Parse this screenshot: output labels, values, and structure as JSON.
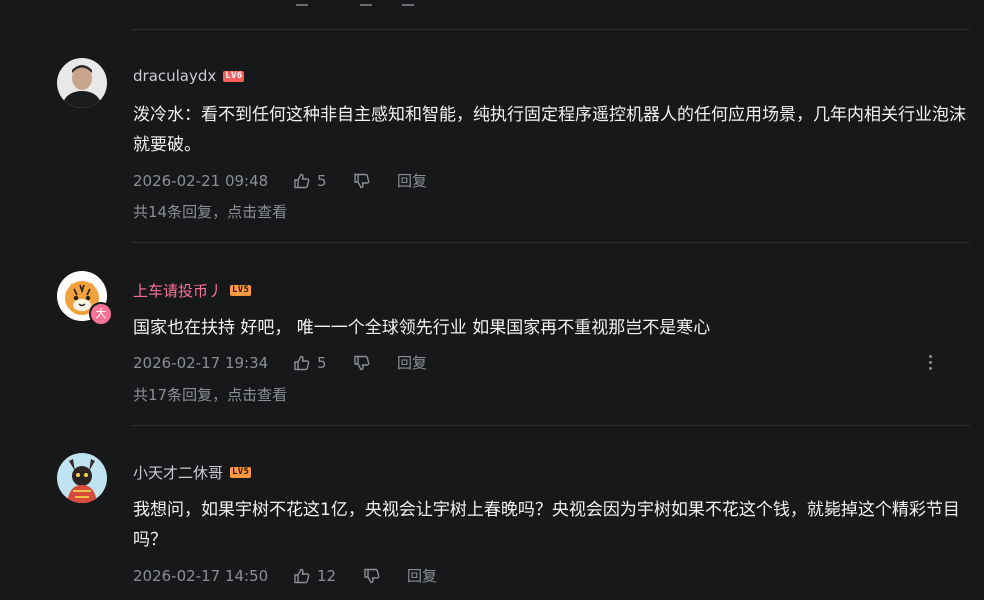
{
  "colors": {
    "background": "#17181a",
    "pink_name": "#fb7299",
    "lv6": "#ff5c5c",
    "lv5": "#ff9a3c",
    "meta": "#8b8f95"
  },
  "comments": [
    {
      "username": "draculaydx",
      "level": "LV6",
      "content": "泼冷水：看不到任何这种非自主感知和智能，纯执行固定程序遥控机器人的任何应用场景，几年内相关行业泡沫就要破。",
      "time": "2026-02-21 09:48",
      "likes": "5",
      "reply_label": "回复",
      "replies_text": "共14条回复，点击查看"
    },
    {
      "username": "上车请投币丿",
      "level": "LV5",
      "avatar_badge": "大",
      "content": "国家也在扶持 好吧， 唯一一个全球领先行业 如果国家再不重视那岂不是寒心",
      "time": "2026-02-17 19:34",
      "likes": "5",
      "reply_label": "回复",
      "replies_text": "共17条回复，点击查看"
    },
    {
      "username": "小天才二休哥",
      "level": "LV5",
      "content": "我想问，如果宇树不花这1亿，央视会让宇树上春晚吗？央视会因为宇树如果不花这个钱，就毙掉这个精彩节目吗？",
      "time": "2026-02-17 14:50",
      "likes": "12",
      "reply_label": "回复"
    }
  ],
  "icons": {
    "like": "thumbs-up-icon",
    "dislike": "thumbs-down-icon",
    "more": "more-vertical-icon"
  }
}
